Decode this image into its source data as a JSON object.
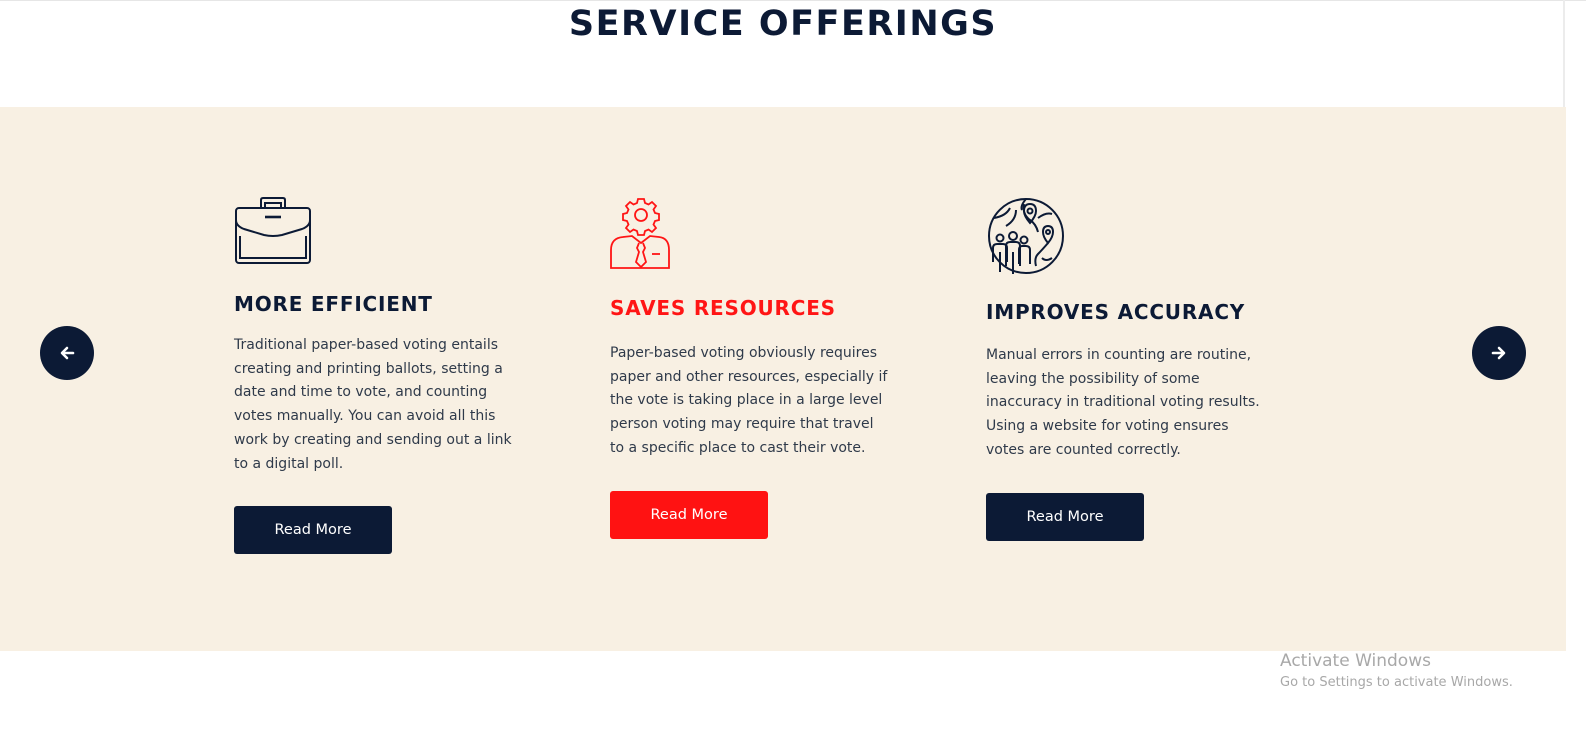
{
  "section": {
    "title": "SERVICE OFFERINGS"
  },
  "carousel": {
    "prev_icon": "arrow-left-icon",
    "next_icon": "arrow-right-icon"
  },
  "cards": [
    {
      "icon": "briefcase-icon",
      "title": "MORE EFFICIENT",
      "text": "Traditional paper-based voting entails creating and printing ballots, setting a date and time to vote, and counting votes manually. You can avoid all this work by creating and sending out a link to a digital poll.",
      "button": "Read More"
    },
    {
      "icon": "person-gear-icon",
      "title": "SAVES RESOURCES",
      "text": "Paper-based voting obviously requires paper and other resources, especially if the vote is taking place in a large level person voting may require that travel to a specific place to cast their vote.",
      "button": "Read More"
    },
    {
      "icon": "globe-people-location-icon",
      "title": "IMPROVES ACCURACY",
      "text": "Manual errors in counting are routine, leaving the possibility of some inaccuracy in traditional voting results. Using a website for voting ensures votes are counted correctly.",
      "button": "Read More"
    }
  ],
  "colors": {
    "navy": "#0c1a35",
    "accent_red": "#ff1212",
    "band_background": "#f8f0e3"
  },
  "watermark": {
    "title": "Activate Windows",
    "subtitle": "Go to Settings to activate Windows."
  }
}
